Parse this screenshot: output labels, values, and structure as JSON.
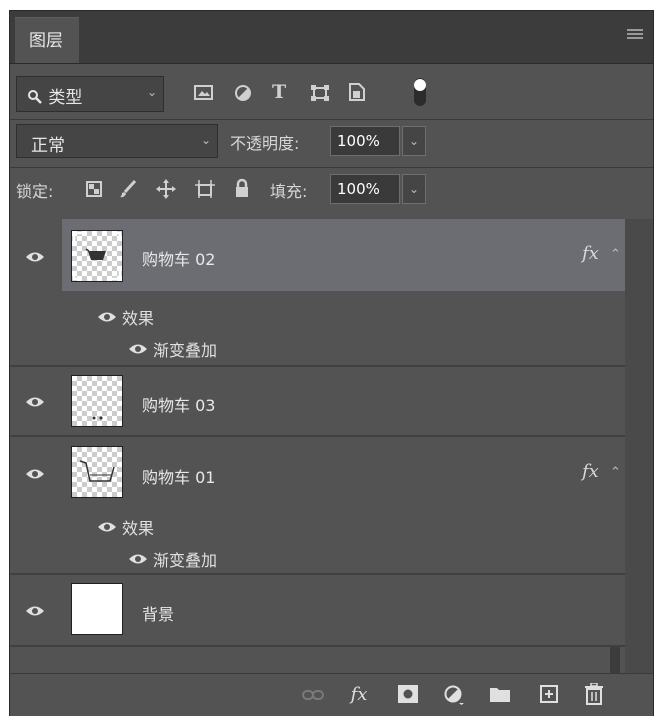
{
  "tab": {
    "label": "图层"
  },
  "filter": {
    "kind_label": "类型",
    "icons": [
      "image-filter-icon",
      "adjustment-filter-icon",
      "type-filter-icon",
      "shape-filter-icon",
      "smart-object-filter-icon",
      "filter-toggle-icon"
    ]
  },
  "blend": {
    "mode": "正常",
    "opacity_label": "不透明度:",
    "opacity_value": "100%"
  },
  "lock": {
    "label": "锁定:",
    "icons": [
      "lock-transparent-pixels-icon",
      "lock-image-pixels-icon",
      "lock-position-icon",
      "lock-artboard-icon",
      "lock-all-icon"
    ],
    "fill_label": "填充:",
    "fill_value": "100%"
  },
  "layers": [
    {
      "name": "购物车 02",
      "selected": true,
      "has_fx": true,
      "fx_label": "fx",
      "effects_label": "效果",
      "effect": "渐变叠加",
      "thumb": "checker"
    },
    {
      "name": "购物车 03",
      "selected": false,
      "has_fx": false,
      "thumb": "checker"
    },
    {
      "name": "购物车 01",
      "selected": false,
      "has_fx": true,
      "fx_label": "fx",
      "effects_label": "效果",
      "effect": "渐变叠加",
      "thumb": "checker"
    },
    {
      "name": "背景",
      "selected": false,
      "has_fx": false,
      "thumb": "white"
    }
  ],
  "bottom_bar": {
    "fx_label": "fx",
    "icons": [
      "link-layers-icon",
      "add-style-icon",
      "add-mask-icon",
      "new-adjustment-icon",
      "new-group-icon",
      "new-layer-icon",
      "delete-layer-icon"
    ]
  },
  "colors": {
    "panel": "#535353",
    "selected_row": "#6b6d72",
    "tab_bar": "#3c3c3c"
  }
}
